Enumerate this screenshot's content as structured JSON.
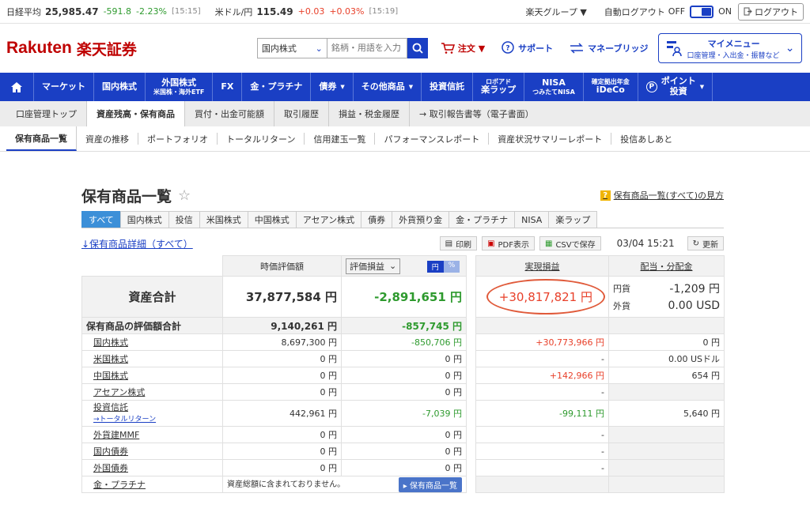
{
  "ticker": [
    {
      "label": "日経平均",
      "value": "25,985.47",
      "change": "-591.8",
      "pct": "-2.23%",
      "time": "[15:15]"
    },
    {
      "label": "米ドル/円",
      "value": "115.49",
      "change": "+0.03",
      "pct": "+0.03%",
      "time": "[15:19]"
    }
  ],
  "topbar": {
    "group": "楽天グループ ▼",
    "autologout": "自動ログアウト",
    "off": "OFF",
    "on": "ON",
    "logout": "ログアウト"
  },
  "header": {
    "logo_en": "Rakuten",
    "logo_jp": "楽天証券",
    "search_select": "国内株式",
    "search_placeholder": "銘柄・用語を入力",
    "order": "注文 ▼",
    "support": "サポート",
    "money_bridge": "マネーブリッジ",
    "mymenu_title": "マイメニュー",
    "mymenu_sub": "口座管理・入出金・振替など"
  },
  "gnav": [
    {
      "l1": "マーケット",
      "l2": ""
    },
    {
      "l1": "国内株式",
      "l2": ""
    },
    {
      "l1": "外国株式",
      "l2": "米国株・海外ETF"
    },
    {
      "l1": "FX",
      "l2": ""
    },
    {
      "l1": "金・プラチナ",
      "l2": ""
    },
    {
      "l1": "債券",
      "l2": ""
    },
    {
      "l1": "その他商品",
      "l2": ""
    },
    {
      "l1": "投資信託",
      "l2": ""
    },
    {
      "l1": "ロボアド",
      "l2": "楽ラップ"
    },
    {
      "l1": "NISA",
      "l2": "つみたてNISA"
    },
    {
      "l1": "確定拠出年金",
      "l2": "iDeCo"
    },
    {
      "l1": "ポイント",
      "l2": "投資"
    }
  ],
  "subnav1": [
    "口座管理トップ",
    "資産残高・保有商品",
    "買付・出金可能額",
    "取引履歴",
    "損益・税金履歴",
    "→ 取引報告書等（電子書面）"
  ],
  "subnav2": [
    "保有商品一覧",
    "資産の推移",
    "ポートフォリオ",
    "トータルリターン",
    "信用建玉一覧",
    "パフォーマンスレポート",
    "資産状況サマリーレポート",
    "投信あしあと"
  ],
  "page": {
    "title": "保有商品一覧",
    "help": "保有商品一覧(すべて)の見方",
    "detail_link": "↓保有商品詳細（すべて）",
    "print": "印刷",
    "pdf": "PDF表示",
    "csv": "CSVで保存",
    "timestamp": "03/04 15:21",
    "refresh": "更新"
  },
  "tabs": [
    "すべて",
    "国内株式",
    "投信",
    "米国株式",
    "中国株式",
    "アセアン株式",
    "債券",
    "外貨預り金",
    "金・プラチナ",
    "NISA",
    "楽ラップ"
  ],
  "table": {
    "h_market": "時価評価額",
    "h_sel": "評価損益",
    "h_yen": "円",
    "h_pct": "%",
    "h_realized": "実現損益",
    "h_dividend": "配当・分配金",
    "asset_total": "資産合計",
    "asset_value": "37,877,584 円",
    "asset_pl": "-2,891,651 円",
    "asset_realized": "+30,817,821 円",
    "div_yen_lbl": "円貨",
    "div_yen": "-1,209 円",
    "div_fx_lbl": "外貨",
    "div_fx": "0.00 USD",
    "holding_total": "保有商品の評価額合計",
    "holding_value": "9,140,261 円",
    "holding_pl": "-857,745 円",
    "rows": [
      {
        "name": "国内株式",
        "sub": "",
        "value": "8,697,300 円",
        "pl": "-850,706 円",
        "realized": "+30,773,966 円",
        "div": "0 円"
      },
      {
        "name": "米国株式",
        "sub": "",
        "value": "0 円",
        "pl": "0 円",
        "realized": "-",
        "div": "0.00 USドル"
      },
      {
        "name": "中国株式",
        "sub": "",
        "value": "0 円",
        "pl": "0 円",
        "realized": "+142,966 円",
        "div": "654 円"
      },
      {
        "name": "アセアン株式",
        "sub": "",
        "value": "0 円",
        "pl": "0 円",
        "realized": "-",
        "div": ""
      },
      {
        "name": "投資信託",
        "sub": "→トータルリターン",
        "value": "442,961 円",
        "pl": "-7,039 円",
        "realized": "-99,111 円",
        "div": "5,640 円"
      },
      {
        "name": "外貨建MMF",
        "sub": "",
        "value": "0 円",
        "pl": "0 円",
        "realized": "-",
        "div": ""
      },
      {
        "name": "国内債券",
        "sub": "",
        "value": "0 円",
        "pl": "0 円",
        "realized": "-",
        "div": ""
      },
      {
        "name": "外国債券",
        "sub": "",
        "value": "0 円",
        "pl": "0 円",
        "realized": "-",
        "div": ""
      }
    ],
    "gold_name": "金・プラチナ",
    "gold_note": "資産総額に含まれておりません。",
    "gold_btn": "▸ 保有商品一覧"
  }
}
